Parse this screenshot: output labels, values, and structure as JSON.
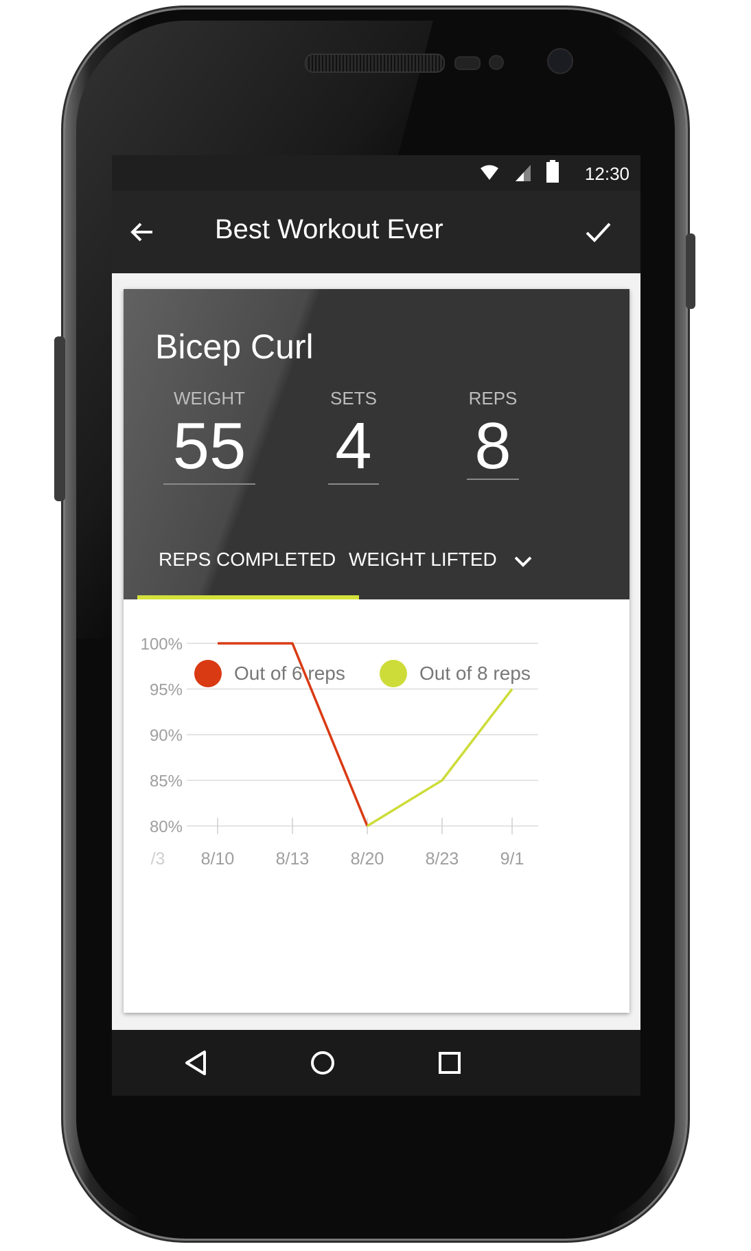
{
  "status_bar": {
    "time": "12:30",
    "icons": [
      "wifi-icon",
      "signal-icon",
      "battery-icon"
    ]
  },
  "app_bar": {
    "title": "Best Workout Ever",
    "back_icon": "arrow-left-icon",
    "confirm_icon": "check-icon"
  },
  "exercise": {
    "name": "Bicep Curl",
    "stats": [
      {
        "label": "WEIGHT",
        "value": "55"
      },
      {
        "label": "SETS",
        "value": "4"
      },
      {
        "label": "REPS",
        "value": "8"
      }
    ]
  },
  "tabs": {
    "items": [
      "REPS COMPLETED",
      "WEIGHT LIFTED"
    ],
    "selected": "REPS COMPLETED",
    "more_icon": "chevron-down-icon"
  },
  "chart_data": {
    "type": "line",
    "y_tick_labels": [
      "100%",
      "95%",
      "90%",
      "85%",
      "80%"
    ],
    "x_tick_labels": [
      "/3",
      "8/10",
      "8/13",
      "8/20",
      "8/23",
      "9/1"
    ],
    "ylim": [
      80,
      100
    ],
    "grid": true,
    "legend_position": "bottom",
    "series": [
      {
        "name": "Out of 6 reps",
        "color": "#d93a13",
        "points": [
          [
            "8/10",
            100
          ],
          [
            "8/13",
            100
          ],
          [
            "8/20",
            80
          ]
        ]
      },
      {
        "name": "Out of 8 reps",
        "color": "#cddc39",
        "points": [
          [
            "8/20",
            80
          ],
          [
            "8/23",
            85
          ],
          [
            "9/1",
            95
          ]
        ]
      }
    ]
  },
  "nav_bar": {
    "icons": [
      "back-triangle-icon",
      "home-circle-icon",
      "recents-square-icon"
    ]
  }
}
